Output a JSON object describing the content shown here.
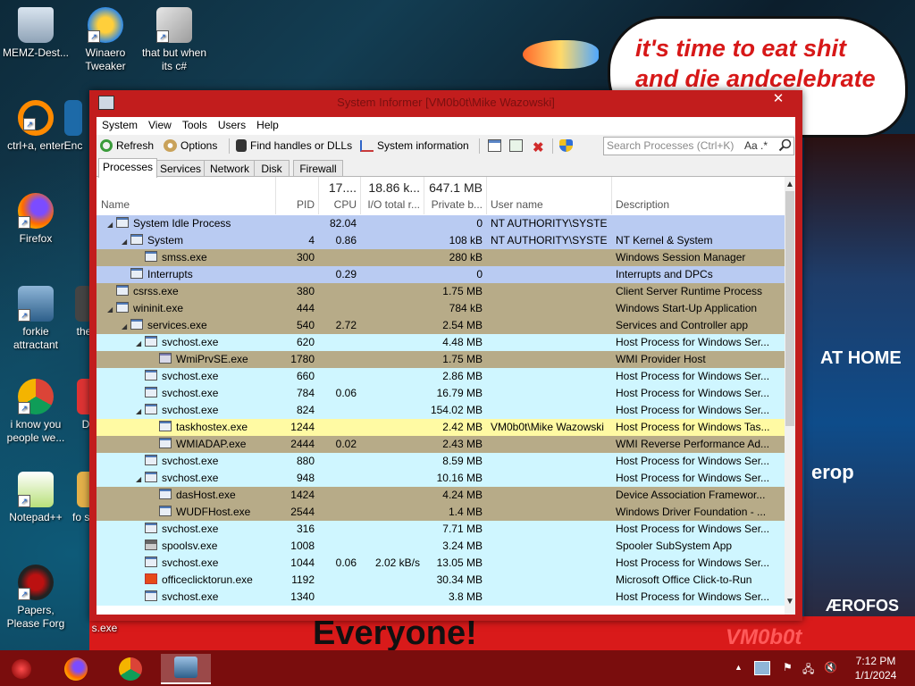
{
  "desktop": {
    "icons": [
      {
        "label": "MEMZ-Dest...",
        "icon": "recycle-bin-icon"
      },
      {
        "label": "Winaero Tweaker",
        "icon": "winaero-icon"
      },
      {
        "label": "that but when its c#",
        "icon": "windows-folder-icon"
      },
      {
        "label": "ctrl+a, enter",
        "icon": "orange-ring-icon"
      },
      {
        "label": "Enc",
        "icon": "app-icon"
      },
      {
        "label": "Firefox",
        "icon": "firefox-icon"
      },
      {
        "label": "forkie attractant",
        "icon": "system-settings-icon"
      },
      {
        "label": "the",
        "icon": "app-icon"
      },
      {
        "label": "i know you people we...",
        "icon": "chrome-icon"
      },
      {
        "label": "D",
        "icon": "app-icon"
      },
      {
        "label": "Notepad++",
        "icon": "notepadpp-icon"
      },
      {
        "label": "fo sor",
        "icon": "app-icon"
      },
      {
        "label": "Papers, Please Forg",
        "icon": "papers-please-icon"
      },
      {
        "label": "s.exe",
        "icon": "app-icon"
      }
    ],
    "bubble_text": "it's time to eat shit and die andcelebrate",
    "banner_text": "Everyone!",
    "vm_text": "VM0b0t",
    "sign_text": "AT HOME",
    "sign2_text": "erop",
    "sign3_text": "ÆROFOS"
  },
  "window": {
    "title": "System Informer [VM0b0t\\Mike Wazowski]",
    "close": "✕",
    "menu": [
      "System",
      "View",
      "Tools",
      "Users",
      "Help"
    ],
    "toolbar": {
      "refresh": "Refresh",
      "options": "Options",
      "find_handles": "Find handles or DLLs",
      "system_info": "System information"
    },
    "search": {
      "placeholder": "Search Processes (Ctrl+K)",
      "case_label": "Aa",
      "regex_label": ".*"
    },
    "tabs": [
      "Processes",
      "Services",
      "Network",
      "Disk",
      "Firewall"
    ],
    "columns": {
      "name": "Name",
      "pid": "PID",
      "cpu": "CPU",
      "io": "I/O total r...",
      "private": "Private b...",
      "user": "User name",
      "description": "Description"
    },
    "summary": {
      "cpu": "17....",
      "io": "18.86 k...",
      "private": "647.1 MB"
    },
    "colors": {
      "system": "#b9cbf2",
      "service": "#cff6ff",
      "own": "#fffaa3",
      "other": "#b7ab88",
      "window_frame": "#c21d1d"
    },
    "processes": [
      {
        "indent": 0,
        "toggle": "◢",
        "name": "System Idle Process",
        "pid": "",
        "cpu": "82.04",
        "io": "",
        "private": "0",
        "user": "NT AUTHORITY\\SYSTEM",
        "description": "",
        "kind": "system",
        "icon": "window-icon"
      },
      {
        "indent": 1,
        "toggle": "◢",
        "name": "System",
        "pid": "4",
        "cpu": "0.86",
        "io": "",
        "private": "108 kB",
        "user": "NT AUTHORITY\\SYSTEM",
        "description": "NT Kernel & System",
        "kind": "system",
        "icon": "window-icon"
      },
      {
        "indent": 2,
        "toggle": "",
        "name": "smss.exe",
        "pid": "300",
        "cpu": "",
        "io": "",
        "private": "280 kB",
        "user": "",
        "description": "Windows Session Manager",
        "kind": "other",
        "icon": "window-icon"
      },
      {
        "indent": 1,
        "toggle": "",
        "name": "Interrupts",
        "pid": "",
        "cpu": "0.29",
        "io": "",
        "private": "0",
        "user": "",
        "description": "Interrupts and DPCs",
        "kind": "system",
        "icon": "window-icon"
      },
      {
        "indent": 0,
        "toggle": "",
        "name": "csrss.exe",
        "pid": "380",
        "cpu": "",
        "io": "",
        "private": "1.75 MB",
        "user": "",
        "description": "Client Server Runtime Process",
        "kind": "other",
        "icon": "window-icon"
      },
      {
        "indent": 0,
        "toggle": "◢",
        "name": "wininit.exe",
        "pid": "444",
        "cpu": "",
        "io": "",
        "private": "784 kB",
        "user": "",
        "description": "Windows Start-Up Application",
        "kind": "other",
        "icon": "window-icon"
      },
      {
        "indent": 1,
        "toggle": "◢",
        "name": "services.exe",
        "pid": "540",
        "cpu": "2.72",
        "io": "",
        "private": "2.54 MB",
        "user": "",
        "description": "Services and Controller app",
        "kind": "other",
        "icon": "window-icon"
      },
      {
        "indent": 2,
        "toggle": "◢",
        "name": "svchost.exe",
        "pid": "620",
        "cpu": "",
        "io": "",
        "private": "4.48 MB",
        "user": "",
        "description": "Host Process for Windows Ser...",
        "kind": "service",
        "icon": "window-icon"
      },
      {
        "indent": 3,
        "toggle": "",
        "name": "WmiPrvSE.exe",
        "pid": "1780",
        "cpu": "",
        "io": "",
        "private": "1.75 MB",
        "user": "",
        "description": "WMI Provider Host",
        "kind": "other",
        "icon": "wmi-icon"
      },
      {
        "indent": 2,
        "toggle": "",
        "name": "svchost.exe",
        "pid": "660",
        "cpu": "",
        "io": "",
        "private": "2.86 MB",
        "user": "",
        "description": "Host Process for Windows Ser...",
        "kind": "service",
        "icon": "window-icon"
      },
      {
        "indent": 2,
        "toggle": "",
        "name": "svchost.exe",
        "pid": "784",
        "cpu": "0.06",
        "io": "",
        "private": "16.79 MB",
        "user": "",
        "description": "Host Process for Windows Ser...",
        "kind": "service",
        "icon": "window-icon"
      },
      {
        "indent": 2,
        "toggle": "◢",
        "name": "svchost.exe",
        "pid": "824",
        "cpu": "",
        "io": "",
        "private": "154.02 MB",
        "user": "",
        "description": "Host Process for Windows Ser...",
        "kind": "service",
        "icon": "window-icon"
      },
      {
        "indent": 3,
        "toggle": "",
        "name": "taskhostex.exe",
        "pid": "1244",
        "cpu": "",
        "io": "",
        "private": "2.42 MB",
        "user": "VM0b0t\\Mike Wazowski",
        "description": "Host Process for Windows Tas...",
        "kind": "own",
        "icon": "window-icon"
      },
      {
        "indent": 3,
        "toggle": "",
        "name": "WMIADAP.exe",
        "pid": "2444",
        "cpu": "0.02",
        "io": "",
        "private": "2.43 MB",
        "user": "",
        "description": "WMI Reverse Performance Ad...",
        "kind": "other",
        "icon": "window-icon"
      },
      {
        "indent": 2,
        "toggle": "",
        "name": "svchost.exe",
        "pid": "880",
        "cpu": "",
        "io": "",
        "private": "8.59 MB",
        "user": "",
        "description": "Host Process for Windows Ser...",
        "kind": "service",
        "icon": "window-icon"
      },
      {
        "indent": 2,
        "toggle": "◢",
        "name": "svchost.exe",
        "pid": "948",
        "cpu": "",
        "io": "",
        "private": "10.16 MB",
        "user": "",
        "description": "Host Process for Windows Ser...",
        "kind": "service",
        "icon": "window-icon"
      },
      {
        "indent": 3,
        "toggle": "",
        "name": "dasHost.exe",
        "pid": "1424",
        "cpu": "",
        "io": "",
        "private": "4.24 MB",
        "user": "",
        "description": "Device Association Framewor...",
        "kind": "other",
        "icon": "window-icon"
      },
      {
        "indent": 3,
        "toggle": "",
        "name": "WUDFHost.exe",
        "pid": "2544",
        "cpu": "",
        "io": "",
        "private": "1.4 MB",
        "user": "",
        "description": "Windows Driver Foundation - ...",
        "kind": "other",
        "icon": "window-icon"
      },
      {
        "indent": 2,
        "toggle": "",
        "name": "svchost.exe",
        "pid": "316",
        "cpu": "",
        "io": "",
        "private": "7.71 MB",
        "user": "",
        "description": "Host Process for Windows Ser...",
        "kind": "service",
        "icon": "window-icon"
      },
      {
        "indent": 2,
        "toggle": "",
        "name": "spoolsv.exe",
        "pid": "1008",
        "cpu": "",
        "io": "",
        "private": "3.24 MB",
        "user": "",
        "description": "Spooler SubSystem App",
        "kind": "service",
        "icon": "printer-icon"
      },
      {
        "indent": 2,
        "toggle": "",
        "name": "svchost.exe",
        "pid": "1044",
        "cpu": "0.06",
        "io": "2.02 kB/s",
        "private": "13.05 MB",
        "user": "",
        "description": "Host Process for Windows Ser...",
        "kind": "service",
        "icon": "window-icon"
      },
      {
        "indent": 2,
        "toggle": "",
        "name": "officeclicktorun.exe",
        "pid": "1192",
        "cpu": "",
        "io": "",
        "private": "30.34 MB",
        "user": "",
        "description": "Microsoft Office Click-to-Run",
        "kind": "service",
        "icon": "office-icon"
      },
      {
        "indent": 2,
        "toggle": "",
        "name": "svchost.exe",
        "pid": "1340",
        "cpu": "",
        "io": "",
        "private": "3.8 MB",
        "user": "",
        "description": "Host Process for Windows Ser...",
        "kind": "service",
        "icon": "window-icon"
      }
    ]
  },
  "taskbar": {
    "apps": [
      "memz-icon",
      "firefox-icon",
      "chrome-icon",
      "system-informer-icon"
    ],
    "tray_chevron": "▲",
    "time": "7:12 PM",
    "date": "1/1/2024"
  }
}
